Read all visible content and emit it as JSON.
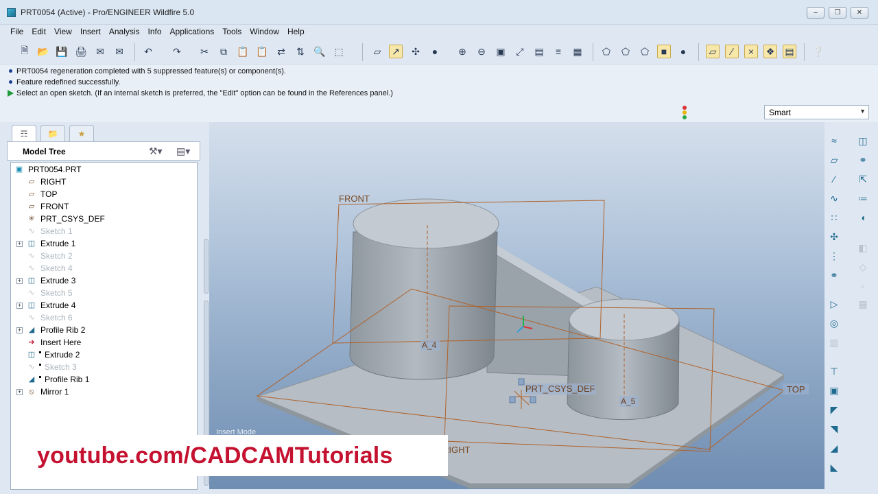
{
  "window": {
    "title": "PRT0054 (Active) - Pro/ENGINEER Wildfire 5.0",
    "controls": [
      "minimize",
      "restore",
      "close"
    ]
  },
  "menu": [
    "File",
    "Edit",
    "View",
    "Insert",
    "Analysis",
    "Info",
    "Applications",
    "Tools",
    "Window",
    "Help"
  ],
  "toolbar": {
    "icons": [
      "new-file",
      "open-folder",
      "save",
      "print",
      "send-mail",
      "send-mail-disabled",
      "undo",
      "redo",
      "cut",
      "copy",
      "paste",
      "paste-special",
      "regenerate",
      "regen-manager",
      "find",
      "select-box",
      "datum-plane-display",
      "datum-axis-display",
      "datum-point-display",
      "shading",
      "zoom-in",
      "zoom-out",
      "refit",
      "reorient",
      "saved-views",
      "layers",
      "view-manager",
      "wireframe",
      "hidden-line",
      "no-hidden",
      "shaded",
      "enhanced-realism",
      "plane-display",
      "axis-display",
      "point-display",
      "csys-display",
      "annotation-display",
      "context-help"
    ]
  },
  "messages": [
    {
      "type": "info",
      "text": "PRT0054 regeneration completed with 5 suppressed feature(s) or component(s)."
    },
    {
      "type": "info",
      "text": "Feature redefined successfully."
    },
    {
      "type": "prompt",
      "text": "Select an open sketch. (If an internal sketch is preferred, the \"Edit\" option can be found in the References panel.)"
    }
  ],
  "filter": {
    "selected": "Smart"
  },
  "left_panel": {
    "tabs": [
      "model-tree",
      "folder-browser",
      "favorites"
    ],
    "header": "Model Tree",
    "tree": [
      {
        "label": "PRT0054.PRT",
        "icon": "part-icon",
        "level": 0,
        "expandable": false,
        "dim": false
      },
      {
        "label": "RIGHT",
        "icon": "datum-plane-icon",
        "level": 1,
        "expandable": false,
        "dim": false
      },
      {
        "label": "TOP",
        "icon": "datum-plane-icon",
        "level": 1,
        "expandable": false,
        "dim": false
      },
      {
        "label": "FRONT",
        "icon": "datum-plane-icon",
        "level": 1,
        "expandable": false,
        "dim": false
      },
      {
        "label": "PRT_CSYS_DEF",
        "icon": "csys-icon",
        "level": 1,
        "expandable": false,
        "dim": false
      },
      {
        "label": "Sketch 1",
        "icon": "sketch-icon",
        "level": 1,
        "expandable": false,
        "dim": true
      },
      {
        "label": "Extrude 1",
        "icon": "extrude-icon",
        "level": 1,
        "expandable": true,
        "dim": false
      },
      {
        "label": "Sketch 2",
        "icon": "sketch-icon",
        "level": 1,
        "expandable": false,
        "dim": true
      },
      {
        "label": "Sketch 4",
        "icon": "sketch-icon",
        "level": 1,
        "expandable": false,
        "dim": true
      },
      {
        "label": "Extrude 3",
        "icon": "extrude-icon",
        "level": 1,
        "expandable": true,
        "dim": false
      },
      {
        "label": "Sketch 5",
        "icon": "sketch-icon",
        "level": 1,
        "expandable": false,
        "dim": true
      },
      {
        "label": "Extrude 4",
        "icon": "extrude-icon",
        "level": 1,
        "expandable": true,
        "dim": false
      },
      {
        "label": "Sketch 6",
        "icon": "sketch-icon",
        "level": 1,
        "expandable": false,
        "dim": true
      },
      {
        "label": "Profile Rib 2",
        "icon": "rib-icon",
        "level": 1,
        "expandable": true,
        "dim": false
      },
      {
        "label": "Insert Here",
        "icon": "insert-arrow-icon",
        "level": 1,
        "expandable": false,
        "dim": false
      },
      {
        "label": "Extrude 2",
        "icon": "extrude-icon",
        "level": 1,
        "expandable": false,
        "dim": false,
        "suppressed": true
      },
      {
        "label": "Sketch 3",
        "icon": "sketch-icon",
        "level": 1,
        "expandable": false,
        "dim": true,
        "suppressed": true
      },
      {
        "label": "Profile Rib 1",
        "icon": "rib-icon",
        "level": 1,
        "expandable": false,
        "dim": false,
        "suppressed": true
      },
      {
        "label": "Mirror 1",
        "icon": "mirror-icon",
        "level": 1,
        "expandable": true,
        "dim": false
      }
    ]
  },
  "viewport": {
    "datum_labels": {
      "front": "FRONT",
      "top": "TOP",
      "right": "RIGHT",
      "csys": "PRT_CSYS_DEF",
      "axis4": "A_4",
      "axis5": "A_5"
    },
    "status_text": "Insert Mode",
    "colors": {
      "model": "#a7afb8",
      "datum": "#b0622a"
    }
  },
  "right_toolbar": {
    "icons": [
      "sketched-curve-icon",
      "datum-plane-tool-icon",
      "datum-axis-tool-icon",
      "datum-curve-icon",
      "datum-point-tool-icon",
      "csys-tool-icon",
      "analysis-feature-icon",
      "chain-icon",
      "copy-paste-icon",
      "extrude-tool-icon",
      "revolve-tool-icon",
      "sweep-tool-icon",
      "blend-tool-icon",
      "style-tool-icon",
      "mirror-tool-icon",
      "merge-tool-icon",
      "trim-tool-icon",
      "pattern-tool-icon",
      "hole-tool-icon",
      "shell-tool-icon",
      "rib-tool-icon",
      "draft-tool-icon",
      "round-tool-icon",
      "chamfer-tool-icon"
    ]
  },
  "watermark": {
    "text": "youtube.com/CADCAMTutorials"
  }
}
